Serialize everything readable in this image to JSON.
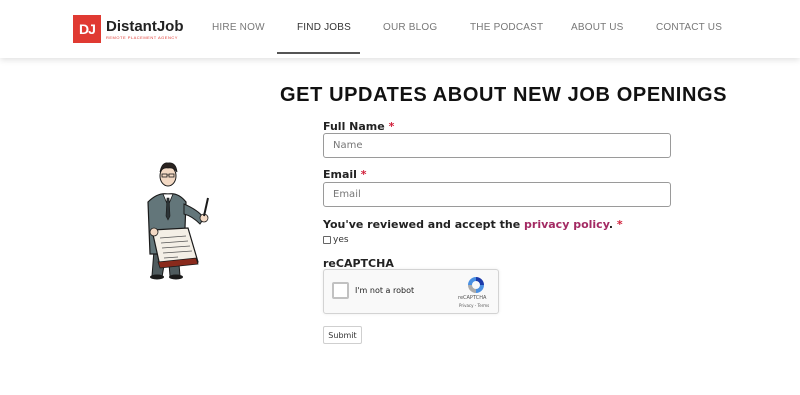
{
  "header": {
    "logo_mark": "DJ",
    "logo_name": "DistantJob",
    "logo_tagline": "REMOTE PLACEMENT AGENCY",
    "nav": [
      {
        "label": "HIRE NOW"
      },
      {
        "label": "FIND JOBS"
      },
      {
        "label": "OUR BLOG"
      },
      {
        "label": "THE PODCAST"
      },
      {
        "label": "ABOUT US"
      },
      {
        "label": "CONTACT US"
      }
    ],
    "active_nav": "FIND JOBS"
  },
  "main": {
    "title": "GET UPDATES ABOUT NEW JOB OPENINGS",
    "form": {
      "full_name_label": "Full Name",
      "full_name_placeholder": "Name",
      "full_name_value": "",
      "email_label": "Email",
      "email_placeholder": "Email",
      "email_value": "",
      "required_mark": "*",
      "privacy_prefix": "You've reviewed and accept the ",
      "privacy_link": "privacy policy",
      "privacy_suffix": ".",
      "yes_label": "yes",
      "yes_checked": false,
      "recaptcha_label": "reCAPTCHA",
      "recaptcha_checkbox_text": "I'm not a robot",
      "recaptcha_brand": "reCAPTCHA",
      "recaptcha_terms": "Privacy - Terms",
      "submit_label": "Submit"
    }
  },
  "colors": {
    "brand_red": "#e03a32",
    "required": "#d11f3a",
    "link": "#a32a63"
  }
}
